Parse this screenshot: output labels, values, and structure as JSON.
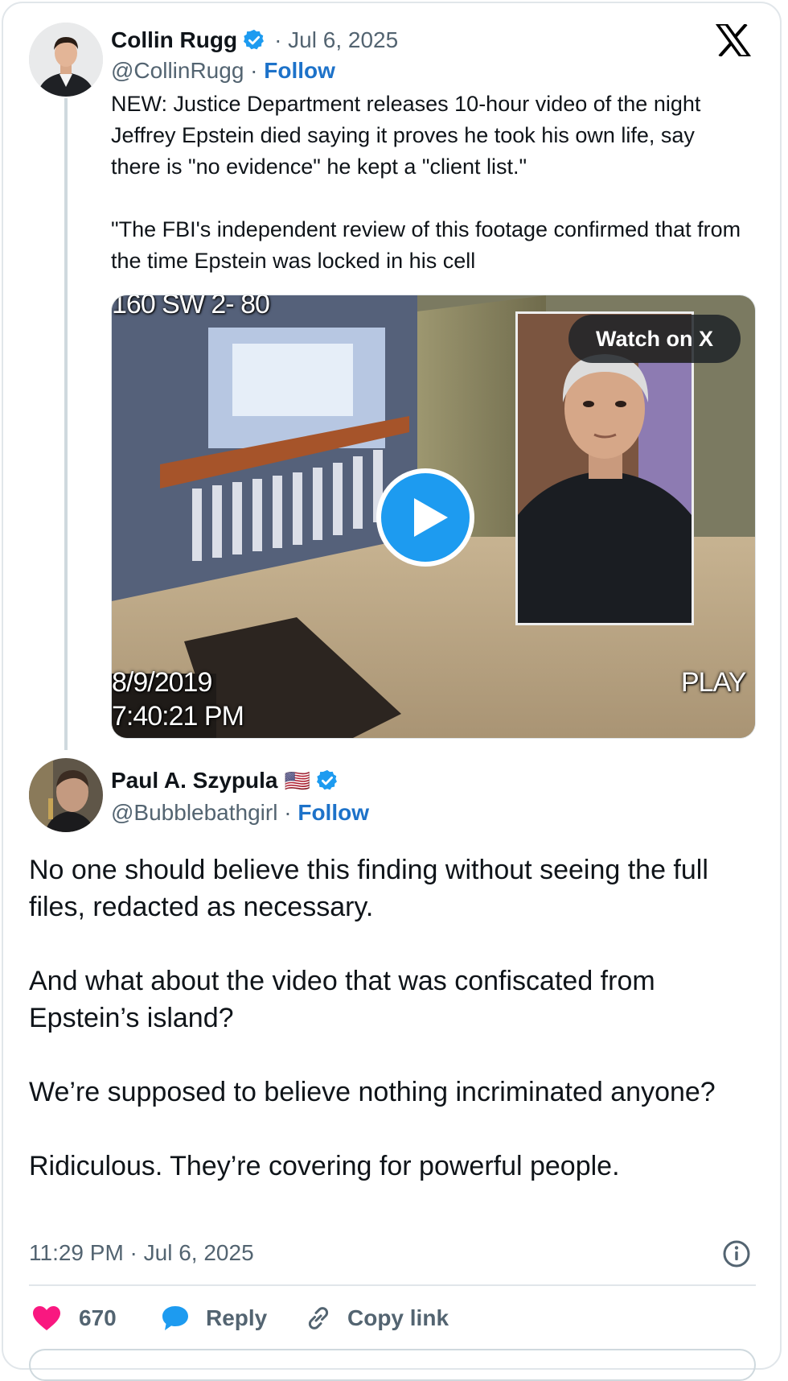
{
  "quoted_tweet": {
    "author_name": "Collin Rugg",
    "date": "· Jul 6, 2025",
    "handle": "@CollinRugg",
    "follow_label": "Follow",
    "separator": "·",
    "text": "NEW: Justice Department releases 10-hour video of the night Jeffrey Epstein died saying it proves he took his own life, say there is \"no evidence\" he kept a \"client list.\"\n\n\"The FBI's independent review of this footage confirmed that from the time Epstein was locked in his cell",
    "media": {
      "watch_label": "Watch on X",
      "overlay_top": "160 SW 2- 80",
      "overlay_date": "8/9/2019",
      "overlay_time": "7:40:21 PM",
      "overlay_play": "PLAY"
    }
  },
  "main_tweet": {
    "author_name": "Paul A. Szypula",
    "flag": "🇺🇸",
    "handle": "@Bubblebathgirl",
    "separator": "·",
    "follow_label": "Follow",
    "text": "No one should believe this finding without seeing the full files, redacted as necessary.\n\nAnd what about the video that was confiscated from Epstein’s island?\n\nWe’re supposed to believe nothing incriminated anyone?\n\nRidiculous. They’re covering for powerful people.",
    "timestamp": "11:29 PM · Jul 6, 2025"
  },
  "actions": {
    "likes_count": "670",
    "reply_label": "Reply",
    "copy_label": "Copy link"
  },
  "icons": {
    "logo": "x-logo-icon",
    "verified": "verified-badge-icon",
    "info": "info-icon",
    "like": "heart-icon",
    "reply": "speech-bubble-icon",
    "copy": "link-icon",
    "play": "play-icon"
  },
  "colors": {
    "accent": "#1d9bf0",
    "follow": "#1d72c9",
    "like": "#f91880",
    "muted": "#536471"
  }
}
